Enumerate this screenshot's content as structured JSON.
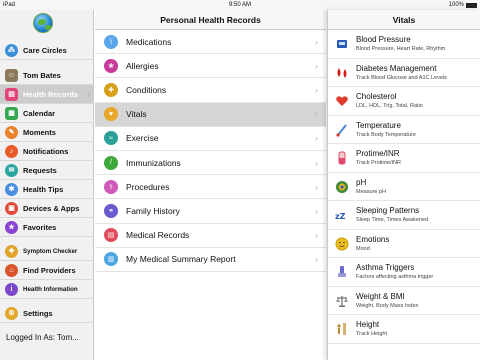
{
  "status": {
    "carrier": "iPad",
    "time": "9:50 AM",
    "battery": "100%"
  },
  "sidebar": {
    "items": [
      {
        "label": "Care Circles",
        "icon": "care-circles-icon",
        "color": "#3a8fd8",
        "glyph": "⁂"
      },
      {
        "label": "Tom Bates",
        "icon": "user-avatar",
        "color": "#8a7a5a",
        "glyph": "☺"
      },
      {
        "label": "Health Records",
        "icon": "health-records-icon",
        "color": "#e0457a",
        "glyph": "▤"
      },
      {
        "label": "Calendar",
        "icon": "calendar-icon",
        "color": "#37a852",
        "glyph": "▦"
      },
      {
        "label": "Moments",
        "icon": "moments-icon",
        "color": "#e8832a",
        "glyph": "✎"
      },
      {
        "label": "Notifications",
        "icon": "bell-icon",
        "color": "#e85b2a",
        "glyph": "♪"
      },
      {
        "label": "Requests",
        "icon": "requests-icon",
        "color": "#2aa6a0",
        "glyph": "✉"
      },
      {
        "label": "Health Tips",
        "icon": "health-tips-icon",
        "color": "#4a8ee0",
        "glyph": "✱"
      },
      {
        "label": "Devices & Apps",
        "icon": "devices-icon",
        "color": "#e04a3a",
        "glyph": "▣"
      },
      {
        "label": "Favorites",
        "icon": "star-icon",
        "color": "#8a44d0",
        "glyph": "★"
      },
      {
        "label": "Symptom Checker",
        "icon": "symptom-checker-icon",
        "color": "#e0a32a",
        "glyph": "✚"
      },
      {
        "label": "Find Providers",
        "icon": "providers-icon",
        "color": "#d8542a",
        "glyph": "⌂"
      },
      {
        "label": "Health Information",
        "icon": "health-info-icon",
        "color": "#7a48c8",
        "glyph": "i"
      },
      {
        "label": "Settings",
        "icon": "gear-icon",
        "color": "#e0a82a",
        "glyph": "⚙"
      }
    ],
    "logged_in": "Logged In As: Tom..."
  },
  "middle": {
    "title": "Personal Health Records",
    "items": [
      {
        "label": "Medications",
        "icon": "medications-icon",
        "color": "#5aa6e8",
        "glyph": "⌇"
      },
      {
        "label": "Allergies",
        "icon": "allergies-icon",
        "color": "#c83a9a",
        "glyph": "❀"
      },
      {
        "label": "Conditions",
        "icon": "conditions-icon",
        "color": "#d8a01a",
        "glyph": "✚"
      },
      {
        "label": "Vitals",
        "icon": "vitals-icon",
        "color": "#e8a62a",
        "glyph": "♥"
      },
      {
        "label": "Exercise",
        "icon": "exercise-icon",
        "color": "#2aa098",
        "glyph": "≈"
      },
      {
        "label": "Immunizations",
        "icon": "immunizations-icon",
        "color": "#3fa83a",
        "glyph": "/"
      },
      {
        "label": "Procedures",
        "icon": "procedures-icon",
        "color": "#d05ab8",
        "glyph": "⚕"
      },
      {
        "label": "Family History",
        "icon": "family-history-icon",
        "color": "#6a5ad0",
        "glyph": "⚭"
      },
      {
        "label": "Medical Records",
        "icon": "medical-records-icon",
        "color": "#e04a5a",
        "glyph": "▤"
      },
      {
        "label": "My Medical Summary Report",
        "icon": "summary-report-icon",
        "color": "#4aa6e0",
        "glyph": "▥"
      }
    ]
  },
  "right": {
    "title": "Vitals",
    "items": [
      {
        "title": "Blood Pressure",
        "subtitle": "Blood Pressure, Heart Rate, Rhythm",
        "icon": "blood-pressure-icon",
        "color": "#2a5ab8"
      },
      {
        "title": "Diabetes Management",
        "subtitle": "Track Blood Glucose and A1C Levels",
        "icon": "blood-drops-icon",
        "color": "#d81a1a"
      },
      {
        "title": "Cholesterol",
        "subtitle": "LDL, HDL, Trig, Total, Ratio",
        "icon": "heart-icon",
        "color": "#e03a2a"
      },
      {
        "title": "Temperature",
        "subtitle": "Track Body Temperature",
        "icon": "thermometer-icon",
        "color": "#4a8ad8"
      },
      {
        "title": "Protime/INR",
        "subtitle": "Track Protime/INR",
        "icon": "test-tube-icon",
        "color": "#e04a6a"
      },
      {
        "title": "pH",
        "subtitle": "Measure pH",
        "icon": "ph-meter-icon",
        "color": "#3a8a3a"
      },
      {
        "title": "Sleeping Patterns",
        "subtitle": "Sleep Time, Times Awakened",
        "icon": "sleep-icon",
        "color": "#2a5ab8"
      },
      {
        "title": "Emotions",
        "subtitle": "Mood",
        "icon": "smiley-icon",
        "color": "#f0c01a"
      },
      {
        "title": "Asthma Triggers",
        "subtitle": "Factors affecting asthma trigger",
        "icon": "inhaler-icon",
        "color": "#6a6ad0"
      },
      {
        "title": "Weight & BMI",
        "subtitle": "Weight, Body Mass Index",
        "icon": "scale-icon",
        "color": "#6a6a6a"
      },
      {
        "title": "Height",
        "subtitle": "Track Height",
        "icon": "height-ruler-icon",
        "color": "#b88a3a"
      }
    ]
  }
}
